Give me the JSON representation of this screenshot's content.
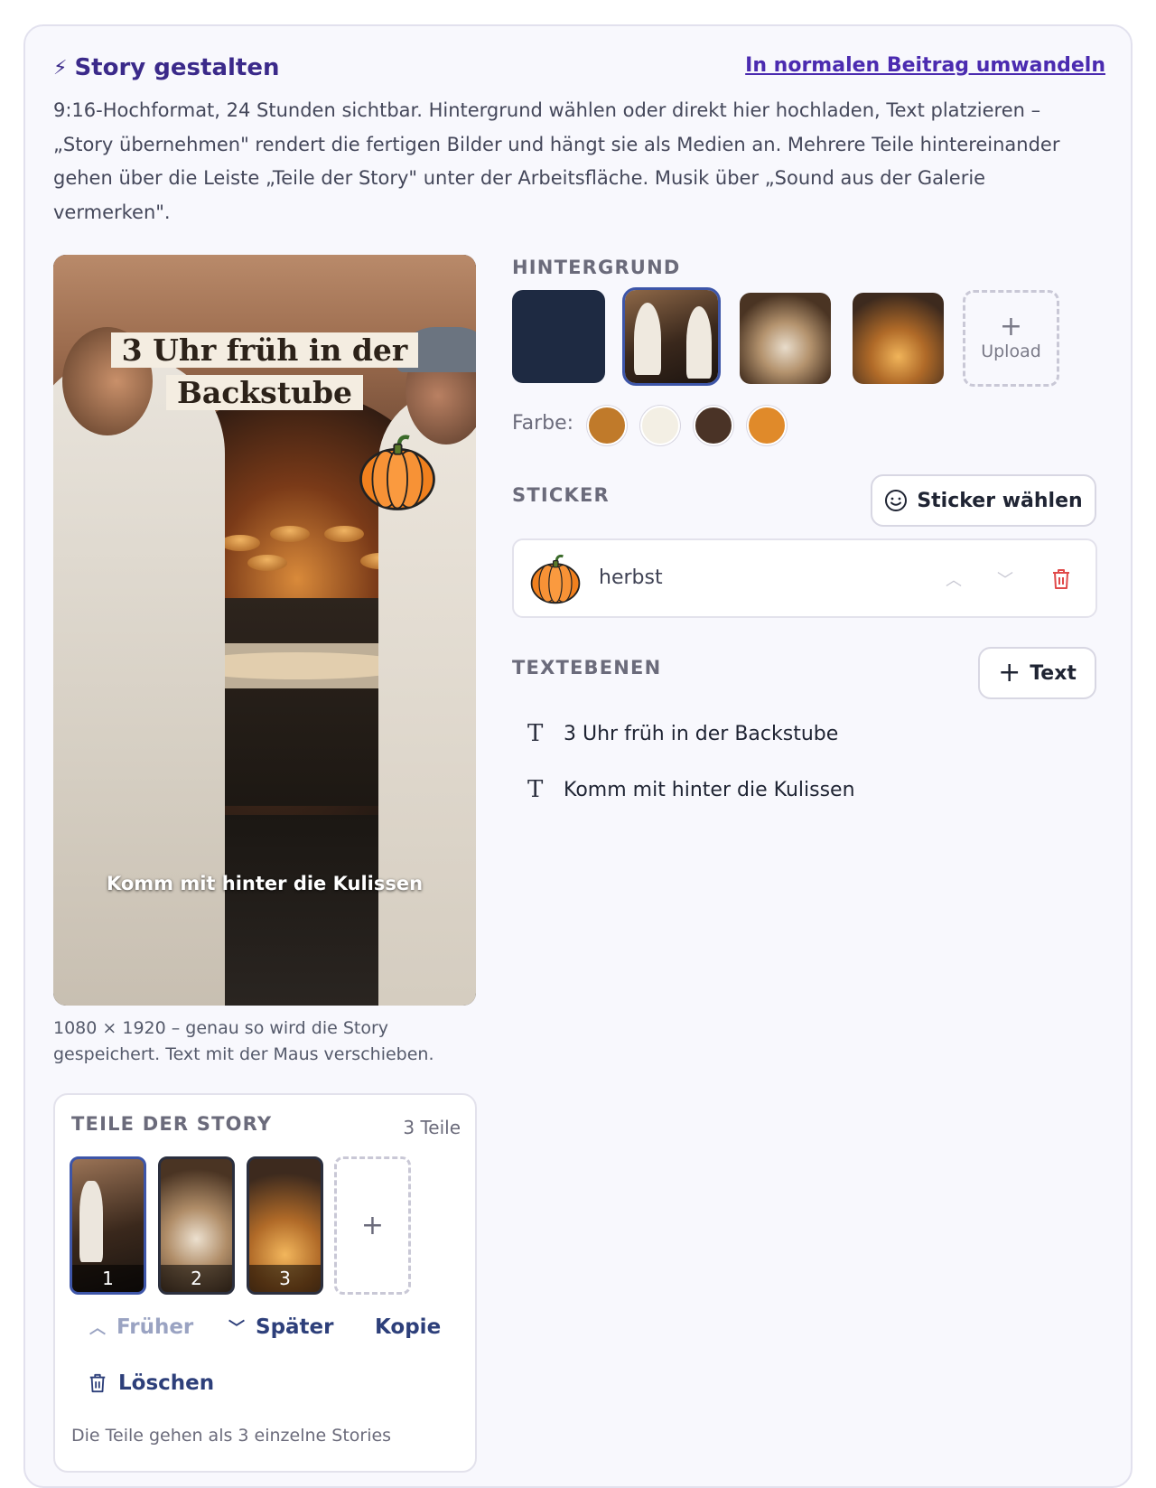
{
  "header": {
    "title": "Story gestalten",
    "title_icon": "bolt-icon",
    "convert_link": "In normalen Beitrag umwandeln",
    "intro": "9:16-Hochformat, 24 Stunden sichtbar. Hintergrund wählen oder direkt hier hochladen, Text platzieren – „Story übernehmen\" rendert die fertigen Bilder und hängt sie als Medien an. Mehrere Teile hintereinander gehen über die Leiste „Teile der Story\" unter der Arbeitsfläche. Musik über „Sound aus der Galerie vermerken\"."
  },
  "canvas": {
    "headline": "3 Uhr früh in der Backstube",
    "subline": "Komm mit hinter die Kulissen",
    "sticker_icon": "pumpkin-icon",
    "caption": "1080 × 1920 – genau so wird die Story gespeichert. Text mit der Maus verschieben."
  },
  "background": {
    "label": "HINTERGRUND",
    "upload_label": "Upload",
    "farbe_label": "Farbe:",
    "swatches": [
      "#c07a2a",
      "#f3efe4",
      "#4a3326",
      "#e08a2a"
    ],
    "selected_index": 1
  },
  "sticker": {
    "label": "STICKER",
    "button": "Sticker wählen",
    "items": [
      {
        "icon": "pumpkin-icon",
        "label": "herbst"
      }
    ]
  },
  "text_layers": {
    "label": "TEXTEBENEN",
    "add_button": "Text",
    "items": [
      {
        "label": "3 Uhr früh in der Backstube"
      },
      {
        "label": "Komm mit hinter die Kulissen"
      }
    ]
  },
  "parts": {
    "label": "TEILE DER STORY",
    "count": "3 Teile",
    "thumbs": [
      "1",
      "2",
      "3"
    ],
    "active_index": 0,
    "actions": {
      "earlier": "Früher",
      "later": "Später",
      "copy": "Kopie",
      "delete": "Löschen"
    },
    "note": "Die Teile gehen als 3 einzelne Stories"
  },
  "colors": {
    "accent": "#3b2a8a",
    "link": "#4b2bb0",
    "selection": "#3d55a8",
    "danger": "#e04a4a"
  }
}
